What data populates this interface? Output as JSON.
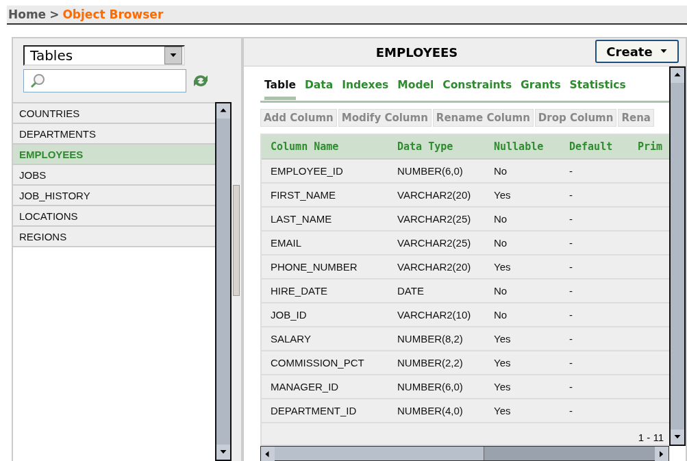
{
  "breadcrumb": {
    "home": "Home",
    "separator": ">",
    "current": "Object Browser"
  },
  "object_type_select": {
    "value": "Tables"
  },
  "objects": [
    {
      "name": "COUNTRIES",
      "selected": false
    },
    {
      "name": "DEPARTMENTS",
      "selected": false
    },
    {
      "name": "EMPLOYEES",
      "selected": true
    },
    {
      "name": "JOBS",
      "selected": false
    },
    {
      "name": "JOB_HISTORY",
      "selected": false
    },
    {
      "name": "LOCATIONS",
      "selected": false
    },
    {
      "name": "REGIONS",
      "selected": false
    }
  ],
  "detail": {
    "title": "EMPLOYEES",
    "create_button": "Create",
    "tabs": [
      {
        "label": "Table",
        "selected": true
      },
      {
        "label": "Data",
        "selected": false
      },
      {
        "label": "Indexes",
        "selected": false
      },
      {
        "label": "Model",
        "selected": false
      },
      {
        "label": "Constraints",
        "selected": false
      },
      {
        "label": "Grants",
        "selected": false
      },
      {
        "label": "Statistics",
        "selected": false
      }
    ],
    "actions": [
      "Add Column",
      "Modify Column",
      "Rename Column",
      "Drop Column",
      "Rena"
    ],
    "table": {
      "columns": [
        "Column Name",
        "Data Type",
        "Nullable",
        "Default",
        "Prim"
      ],
      "rows": [
        [
          "EMPLOYEE_ID",
          "NUMBER(6,0)",
          "No",
          "-"
        ],
        [
          "FIRST_NAME",
          "VARCHAR2(20)",
          "Yes",
          "-"
        ],
        [
          "LAST_NAME",
          "VARCHAR2(25)",
          "No",
          "-"
        ],
        [
          "EMAIL",
          "VARCHAR2(25)",
          "No",
          "-"
        ],
        [
          "PHONE_NUMBER",
          "VARCHAR2(20)",
          "Yes",
          "-"
        ],
        [
          "HIRE_DATE",
          "DATE",
          "No",
          "-"
        ],
        [
          "JOB_ID",
          "VARCHAR2(10)",
          "No",
          "-"
        ],
        [
          "SALARY",
          "NUMBER(8,2)",
          "Yes",
          "-"
        ],
        [
          "COMMISSION_PCT",
          "NUMBER(2,2)",
          "Yes",
          "-"
        ],
        [
          "MANAGER_ID",
          "NUMBER(6,0)",
          "Yes",
          "-"
        ],
        [
          "DEPARTMENT_ID",
          "NUMBER(4,0)",
          "Yes",
          "-"
        ]
      ]
    },
    "pagination": "1 - 11"
  }
}
